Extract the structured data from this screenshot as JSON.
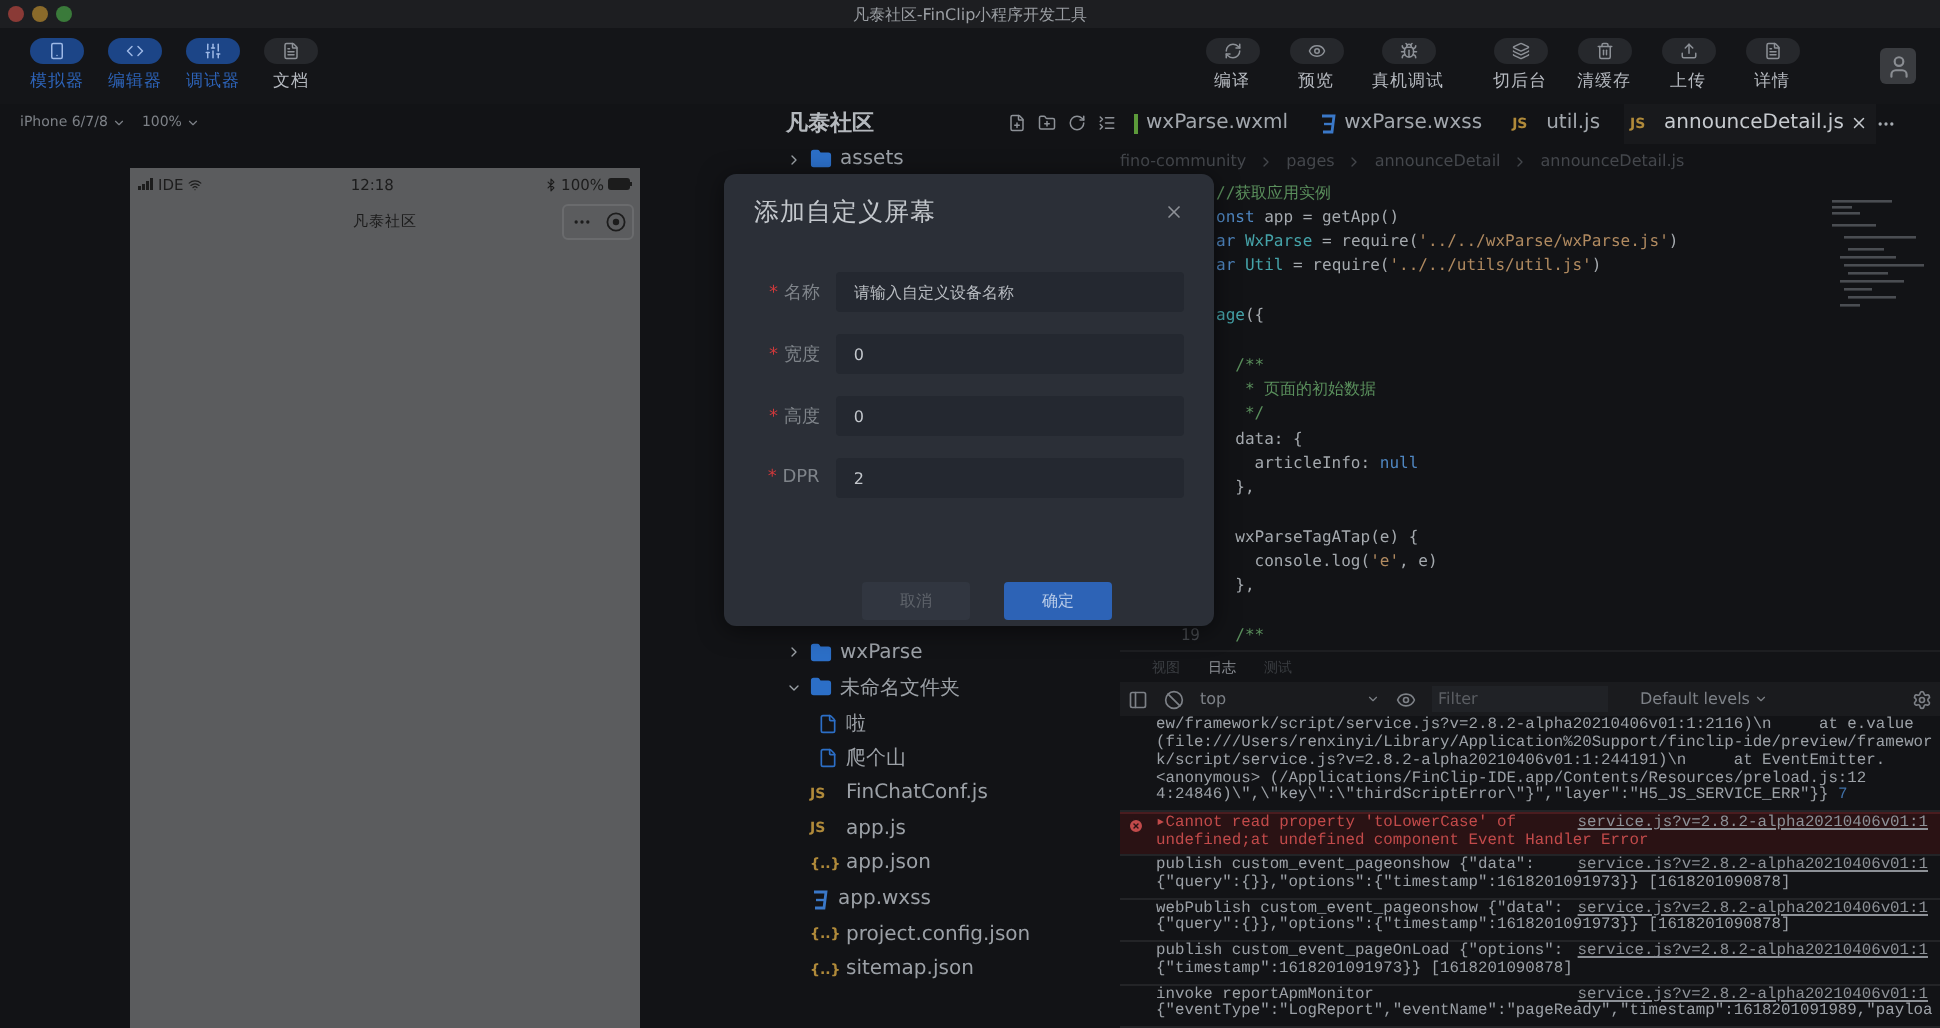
{
  "window": {
    "title": "凡泰社区-FinClip小程序开发工具"
  },
  "toolbar": {
    "left": [
      {
        "label": "模拟器",
        "kind": "phone",
        "on": true
      },
      {
        "label": "编辑器",
        "kind": "code",
        "on": true
      },
      {
        "label": "调试器",
        "kind": "sliders",
        "on": true
      },
      {
        "label": "文档",
        "kind": "doc",
        "on": false
      }
    ],
    "right": [
      {
        "label": "编译",
        "kind": "refresh"
      },
      {
        "label": "预览",
        "kind": "eye"
      },
      {
        "label": "真机调试",
        "kind": "bug"
      },
      {
        "label": "切后台",
        "kind": "layers"
      },
      {
        "label": "清缓存",
        "kind": "trash"
      },
      {
        "label": "上传",
        "kind": "upload"
      },
      {
        "label": "详情",
        "kind": "doc"
      }
    ]
  },
  "simulator": {
    "device": "iPhone 6/7/8",
    "zoom": "100%",
    "carrier": "IDE",
    "time": "12:18",
    "battery": "100%",
    "nav_title": "凡泰社区"
  },
  "explorer": {
    "title": "凡泰社区",
    "items": [
      {
        "name": "assets",
        "kind": "folder",
        "expanded": false
      },
      {
        "name": "wxParse",
        "kind": "folder",
        "expanded": false
      },
      {
        "name": "未命名文件夹",
        "kind": "folder",
        "expanded": true,
        "children": [
          {
            "name": "啦",
            "kind": "file"
          },
          {
            "name": "爬个山",
            "kind": "file"
          }
        ]
      },
      {
        "name": "FinChatConf.js",
        "kind": "badge",
        "badge": "JS"
      },
      {
        "name": "app.js",
        "kind": "badge",
        "badge": "JS"
      },
      {
        "name": "app.json",
        "kind": "badge",
        "badge": "{..}"
      },
      {
        "name": "app.wxss",
        "kind": "wxss"
      },
      {
        "name": "project.config.json",
        "kind": "badge",
        "badge": "{..}"
      },
      {
        "name": "sitemap.json",
        "kind": "badge",
        "badge": "{..}"
      }
    ]
  },
  "tabs": [
    {
      "label": "wxParse.wxml",
      "kind": "wxml",
      "selected": false
    },
    {
      "label": "wxParse.wxss",
      "kind": "wxss",
      "selected": false
    },
    {
      "label": "util.js",
      "kind": "badge",
      "badge": "JS",
      "selected": false
    },
    {
      "label": "announceDetail.js",
      "kind": "badge",
      "badge": "JS",
      "selected": true
    }
  ],
  "breadcrumb": [
    "fino-community",
    "pages",
    "announceDetail",
    "announceDetail.js"
  ],
  "code": [
    {
      "kind": "code",
      "tokens": [
        {
          "t": "//获取应用实例",
          "kind": "comment"
        }
      ]
    },
    {
      "kind": "code",
      "tokens": [
        {
          "t": "onst",
          "kind": "keyword"
        },
        {
          "t": " app = getApp()",
          "kind": "plain"
        }
      ]
    },
    {
      "kind": "code",
      "tokens": [
        {
          "t": "ar",
          "kind": "keyword"
        },
        {
          "t": " WxParse",
          "kind": "var"
        },
        {
          "t": " = require(",
          "kind": "plain"
        },
        {
          "t": "'../../wxParse/wxParse.js'",
          "kind": "string"
        },
        {
          "t": ")",
          "kind": "plain"
        }
      ]
    },
    {
      "kind": "code",
      "tokens": [
        {
          "t": "ar",
          "kind": "keyword"
        },
        {
          "t": " Util",
          "kind": "var"
        },
        {
          "t": " = require(",
          "kind": "plain"
        },
        {
          "t": "'../../utils/util.js'",
          "kind": "string"
        },
        {
          "t": ")",
          "kind": "plain"
        }
      ]
    },
    {
      "kind": "blank"
    },
    {
      "kind": "code",
      "tokens": [
        {
          "t": "age",
          "kind": "var"
        },
        {
          "t": "({",
          "kind": "plain"
        }
      ]
    },
    {
      "kind": "blank"
    },
    {
      "kind": "code",
      "tokens": [
        {
          "t": "  /**",
          "kind": "comment"
        }
      ]
    },
    {
      "kind": "code",
      "tokens": [
        {
          "t": "   * 页面的初始数据",
          "kind": "comment"
        }
      ]
    },
    {
      "kind": "code",
      "tokens": [
        {
          "t": "   */",
          "kind": "comment"
        }
      ]
    },
    {
      "kind": "code",
      "tokens": [
        {
          "t": "  data: {",
          "kind": "plain"
        }
      ]
    },
    {
      "kind": "code",
      "tokens": [
        {
          "t": "    articleInfo: ",
          "kind": "plain"
        },
        {
          "t": "null",
          "kind": "keyword"
        }
      ]
    },
    {
      "kind": "code",
      "tokens": [
        {
          "t": "  },",
          "kind": "plain"
        }
      ]
    },
    {
      "kind": "blank"
    },
    {
      "kind": "code",
      "tokens": [
        {
          "t": "  wxParseTagATap(e) {",
          "kind": "plain"
        }
      ]
    },
    {
      "kind": "code",
      "tokens": [
        {
          "t": "    console.log(",
          "kind": "plain"
        },
        {
          "t": "'e'",
          "kind": "string"
        },
        {
          "t": ", e)",
          "kind": "plain"
        }
      ]
    },
    {
      "kind": "code",
      "tokens": [
        {
          "t": "  },",
          "kind": "plain"
        }
      ]
    },
    {
      "kind": "blank"
    },
    {
      "kind": "code",
      "number": "19",
      "tokens": [
        {
          "t": "  /**",
          "kind": "comment"
        }
      ]
    }
  ],
  "console": {
    "tabs": [
      {
        "label": "视图",
        "selected": false
      },
      {
        "label": "日志",
        "selected": true
      },
      {
        "label": "测试",
        "selected": false
      }
    ],
    "context": "top",
    "filter_placeholder": "Filter",
    "levels": "Default levels",
    "messages": [
      {
        "kind": "log",
        "lines": [
          "ew/framework/script/service.js?v=2.8.2-alpha20210406v01:1:2116)\\n     at e.value",
          "(file:///Users/renxinyi/Library/Application%20Support/finclip-ide/preview/framewor",
          "k/script/service.js?v=2.8.2-alpha20210406v01:1:244191)\\n     at EventEmitter.",
          "<anonymous> (/Applications/FinClip-IDE.app/Contents/Resources/preload.js:12",
          "4:24846)\\\",\\\"key\\\":\\\"thirdScriptError\\\"}\",\"layer\":\"H5_JS_SERVICE_ERR\"}}"
        ],
        "count": "7"
      },
      {
        "kind": "error",
        "toggle": "▸",
        "lines": [
          "Cannot read property 'toLowerCase' of",
          "undefined;at undefined component Event Handler Error"
        ],
        "source": "service.js?v=2.8.2-alpha20210406v01:1"
      },
      {
        "kind": "log",
        "lines": [
          "publish custom_event_pageonshow {\"data\":",
          "{\"query\":{}},\"options\":{\"timestamp\":1618201091973}} [1618201090878]"
        ],
        "source": "service.js?v=2.8.2-alpha20210406v01:1"
      },
      {
        "kind": "log",
        "lines": [
          "webPublish custom_event_pageonshow {\"data\":",
          "{\"query\":{}},\"options\":{\"timestamp\":1618201091973}} [1618201090878]"
        ],
        "source": "service.js?v=2.8.2-alpha20210406v01:1"
      },
      {
        "kind": "log",
        "lines": [
          "publish custom_event_pageOnLoad {\"options\":",
          "{\"timestamp\":1618201091973}} [1618201090878]"
        ],
        "source": "service.js?v=2.8.2-alpha20210406v01:1"
      },
      {
        "kind": "log",
        "lines": [
          "invoke reportApmMonitor",
          "{\"eventType\":\"LogReport\",\"eventName\":\"pageReady\",\"timestamp\":1618201091989,\"payloa"
        ],
        "source": "service.js?v=2.8.2-alpha20210406v01:1"
      }
    ]
  },
  "dialog": {
    "title": "添加自定义屏幕",
    "fields": [
      {
        "label": "名称",
        "required_mark": "*",
        "placeholder": "请输入自定义设备名称"
      },
      {
        "label": "宽度",
        "required_mark": "*",
        "value": "0"
      },
      {
        "label": "高度",
        "required_mark": "*",
        "value": "0"
      },
      {
        "label": "DPR",
        "required_mark": "*",
        "value": "2"
      }
    ],
    "buttons": [
      {
        "label": "取消",
        "kind": "secondary"
      },
      {
        "label": "确定",
        "kind": "primary"
      }
    ]
  }
}
